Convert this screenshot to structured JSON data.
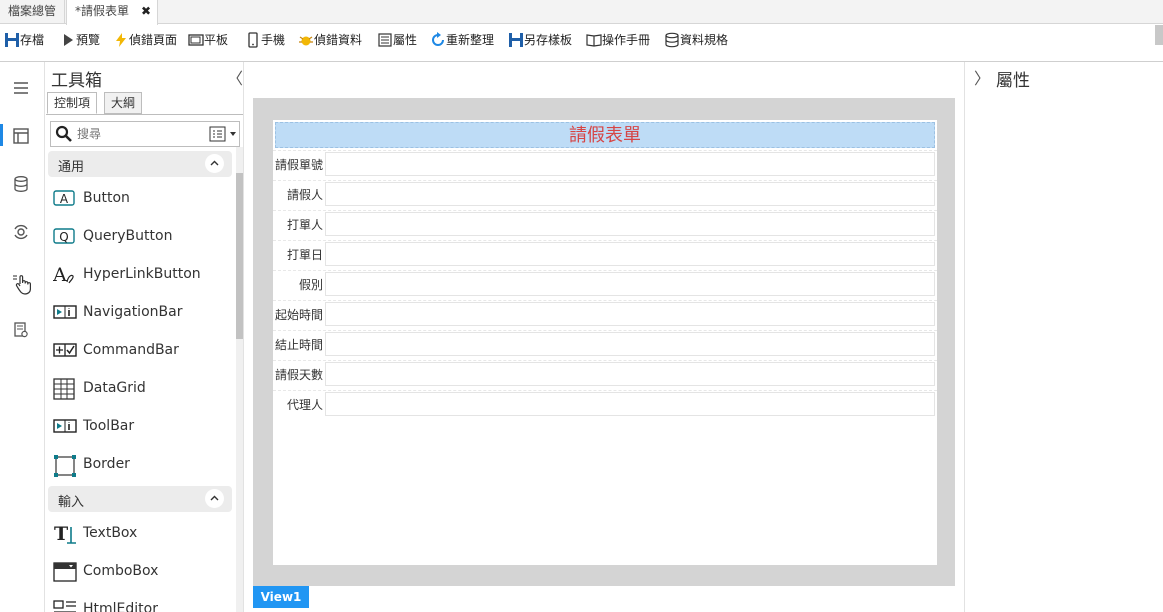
{
  "tabs": [
    {
      "label": "檔案總管"
    },
    {
      "label": "*請假表單",
      "close": "✖"
    }
  ],
  "toolbar": {
    "save": "存檔",
    "preview": "預覽",
    "debug_page": "偵錯頁面",
    "tablet": "平板",
    "phone": "手機",
    "debug_data": "偵錯資料",
    "properties": "屬性",
    "refresh": "重新整理",
    "save_template": "另存樣板",
    "manual": "操作手冊",
    "data_spec": "資料規格"
  },
  "toolbox": {
    "title": "工具箱",
    "collapse": "〈",
    "tabs": [
      "控制項",
      "大綱"
    ],
    "search_placeholder": "搜尋",
    "sections": [
      {
        "label": "通用",
        "items": [
          "Button",
          "QueryButton",
          "HyperLinkButton",
          "NavigationBar",
          "CommandBar",
          "DataGrid",
          "ToolBar",
          "Border"
        ]
      },
      {
        "label": "輸入",
        "items": [
          "TextBox",
          "ComboBox",
          "HtmlEditor"
        ]
      }
    ]
  },
  "form": {
    "title": "請假表單",
    "fields": [
      "請假單號",
      "請假人",
      "打單人",
      "打單日",
      "假別",
      "起始時間",
      "結止時間",
      "請假天數",
      "代理人"
    ]
  },
  "view_tab": "View1",
  "properties": {
    "chevron": "〉",
    "title": "屬性"
  },
  "colors": {
    "accent": "#2196f3",
    "title_text": "#d64545",
    "title_bg": "#bedcf6"
  }
}
